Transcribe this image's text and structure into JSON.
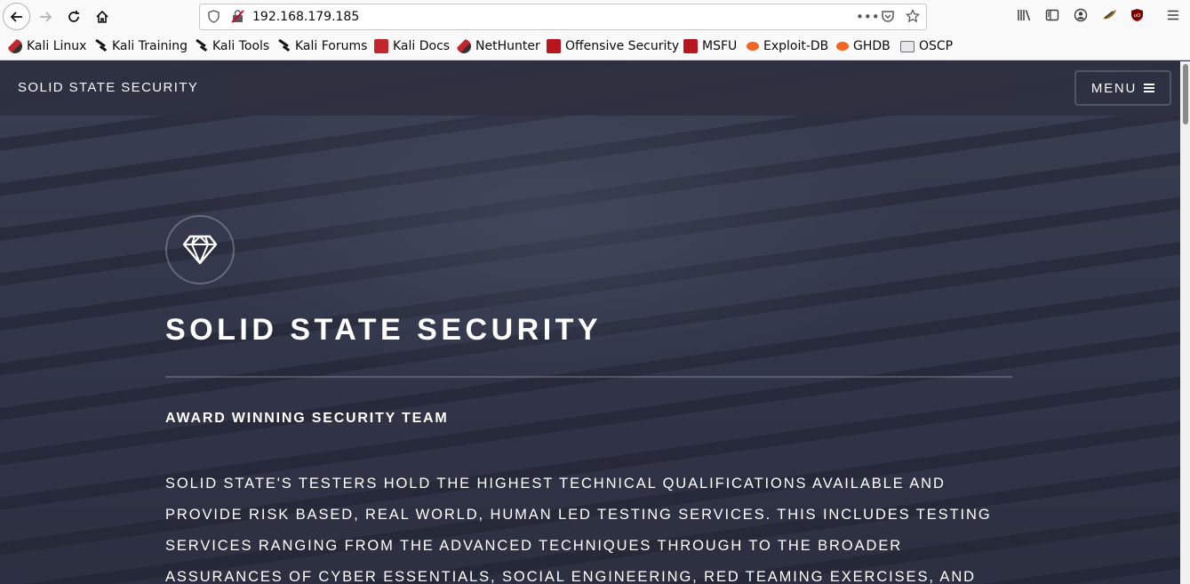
{
  "browser": {
    "url": "192.168.179.185",
    "bookmarks": [
      {
        "label": "Kali Linux",
        "icon": "kali-icon"
      },
      {
        "label": "Kali Training",
        "icon": "kali-dragon-icon"
      },
      {
        "label": "Kali Tools",
        "icon": "kali-dragon-icon"
      },
      {
        "label": "Kali Forums",
        "icon": "kali-dragon-icon"
      },
      {
        "label": "Kali Docs",
        "icon": "kali-docs-icon"
      },
      {
        "label": "NetHunter",
        "icon": "kali-icon"
      },
      {
        "label": "Offensive Security",
        "icon": "offsec-icon"
      },
      {
        "label": "MSFU",
        "icon": "offsec-icon"
      },
      {
        "label": "Exploit-DB",
        "icon": "exploit-db-icon"
      },
      {
        "label": "GHDB",
        "icon": "exploit-db-icon"
      },
      {
        "label": "OSCP",
        "icon": "folder-icon"
      }
    ]
  },
  "site": {
    "header_title": "SOLID STATE SECURITY",
    "menu_label": "MENU"
  },
  "hero": {
    "title": "SOLID STATE SECURITY",
    "subtitle": "AWARD WINNING SECURITY TEAM",
    "body": "Solid State's testers hold the highest technical qualifications available and provide risk based, real world, human led testing services. This includes testing services ranging from the advanced techniques through to the broader assurances of Cyber Essentials, Social Engineering, Red Teaming exercises, and"
  }
}
